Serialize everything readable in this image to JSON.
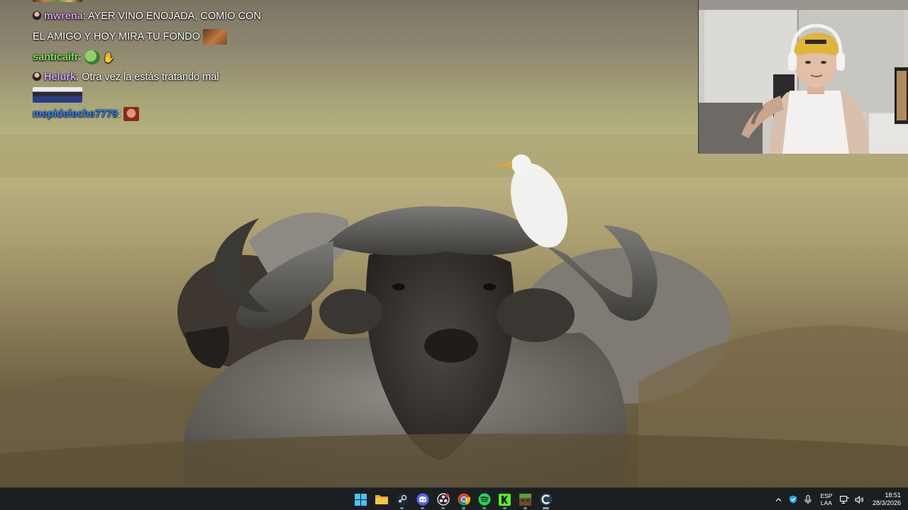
{
  "chat": {
    "messages": [
      {
        "user": "mwrena",
        "user_color": "#d39be8",
        "has_badge": true,
        "text_line1": "AYER VINO ENOJADA, COMIO CON",
        "text_line2": "EL AMIGO Y HOY MIRA TU FONDO"
      },
      {
        "user": "santicaifr",
        "user_color": "#7fe15a",
        "has_badge": false,
        "text_line1": ""
      },
      {
        "user": "Helurk",
        "user_color": "#c9a6ff",
        "has_badge": true,
        "text_line1": "Otra vez la estás tratando mal"
      },
      {
        "user": "mepideleche7779",
        "user_color": "#2f7cff",
        "has_badge": false,
        "text_line1": ""
      }
    ]
  },
  "taskbar": {
    "apps": [
      {
        "icon": "windows-start-icon",
        "name": "start"
      },
      {
        "icon": "file-explorer-icon",
        "name": "file-explorer"
      },
      {
        "icon": "steam-icon",
        "name": "steam"
      },
      {
        "icon": "discord-icon",
        "name": "discord"
      },
      {
        "icon": "obs-icon",
        "name": "obs"
      },
      {
        "icon": "chrome-icon",
        "name": "chrome"
      },
      {
        "icon": "spotify-icon",
        "name": "spotify"
      },
      {
        "icon": "kick-icon",
        "name": "kick"
      },
      {
        "icon": "minecraft-icon",
        "name": "minecraft"
      },
      {
        "icon": "game-launcher-icon",
        "name": "launcher"
      }
    ],
    "tray": {
      "language_top": "ESP",
      "language_bottom": "LAA",
      "time": "18:51",
      "date": "28/3/2026"
    }
  },
  "colors": {
    "taskbar_bg": "#1c1f22",
    "spotify": "#1ed760",
    "kick": "#53fc18",
    "folder": "#f4c542",
    "windows": "#4cc2ff"
  }
}
